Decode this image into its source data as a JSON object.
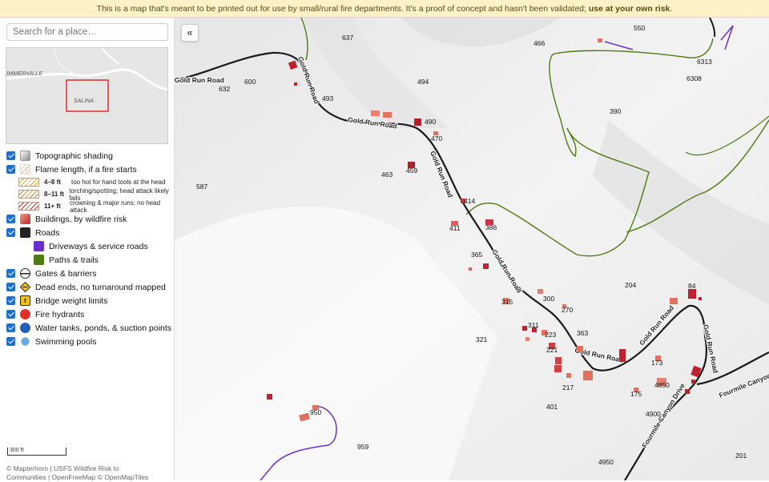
{
  "banner": {
    "text": "This is a map that's meant to be printed out for use by small/rural fire departments. It's a proof of concept and hasn't been validated; ",
    "warning": "use at your own risk",
    "end": "."
  },
  "search": {
    "placeholder": "Search for a place…"
  },
  "minimap": {
    "labels": [
      "IMMERVILLE",
      "SALINA"
    ]
  },
  "collapse_button": "«",
  "layers": {
    "topo": "Topographic shading",
    "flame": "Flame length, if a fire starts",
    "flame_levels": [
      {
        "range": "4–8 ft",
        "desc": "too hot for hand tools at the head"
      },
      {
        "range": "8–11 ft",
        "desc": "torching/spotting; head attack likely fails"
      },
      {
        "range": "11+ ft",
        "desc": "crowning & major runs; no head attack"
      }
    ],
    "buildings": "Buildings, by wildfire risk",
    "roads": "Roads",
    "driveways": "Driveways & service roads",
    "paths": "Paths & trails",
    "gates": "Gates & barriers",
    "deadends": "Dead ends, no turnaround mapped",
    "bridges": "Bridge weight limits",
    "hydrants": "Fire hydrants",
    "water": "Water tanks, ponds, & suction points",
    "pools": "Swimming pools"
  },
  "colors": {
    "road": "#1a1a1a",
    "driveway": "#6a2fc8",
    "trail": "#4d7a12",
    "building_high": "#c0202a",
    "building_low": "#e8806a",
    "hydrant": "#e0302a",
    "water": "#1f5fb8",
    "pool": "#6fa8dc",
    "bridge": "#f0c020"
  },
  "scalebar": "300 ft",
  "attribution": "© Mapterhorn | USFS Wildfire Risk to Communities | OpenFreeMap © OpenMapTiles",
  "map": {
    "road_labels": [
      "Gold Run Road",
      "Gold Run Road",
      "Gold Run Road",
      "Gold Run Road",
      "Gold Run Road",
      "Gold Run Road",
      "Gold Run Road",
      "Fourmile Canyon Drive",
      "Fourmile Canyon Dr"
    ],
    "addresses": [
      "637",
      "466",
      "550",
      "6313",
      "6308",
      "600",
      "632",
      "494",
      "493",
      "390",
      "490",
      "470",
      "463",
      "459",
      "587",
      "414",
      "411",
      "386",
      "365",
      "204",
      "84",
      "300",
      "315",
      "270",
      "311",
      "223",
      "363",
      "321",
      "221",
      "173",
      "4850",
      "175",
      "217",
      "401",
      "4900",
      "950",
      "959",
      "4950",
      "201"
    ]
  }
}
